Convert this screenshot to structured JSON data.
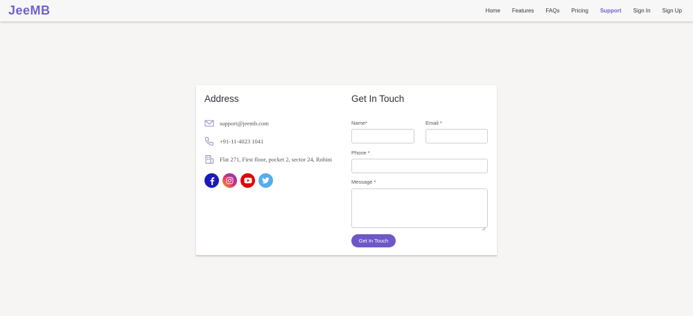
{
  "header": {
    "logo": "JeeMB",
    "nav": [
      {
        "label": "Home"
      },
      {
        "label": "Features"
      },
      {
        "label": "FAQs"
      },
      {
        "label": "Pricing"
      },
      {
        "label": "Support",
        "active": true
      },
      {
        "label": "Sign In"
      },
      {
        "label": "Sign Up"
      }
    ]
  },
  "address": {
    "title": "Address",
    "email": "support@jeemb.com",
    "phone": "+91-11-4023 1041",
    "location": "Flat 271, First floor, pocket 2, sector 24, Rohini",
    "icons": [
      "envelope-icon",
      "phone-icon",
      "building-icon"
    ],
    "social": [
      {
        "name": "facebook-icon",
        "color": "#1a1abf"
      },
      {
        "name": "instagram-icon",
        "color": "#d62976"
      },
      {
        "name": "youtube-icon",
        "color": "#e00000"
      },
      {
        "name": "twitter-icon",
        "color": "#55acee"
      }
    ]
  },
  "form": {
    "title": "Get In Touch",
    "name_label": "Name*",
    "email_label": "Email *",
    "phone_label": "Phone *",
    "message_label": "Message *",
    "name_value": "",
    "email_value": "",
    "phone_value": "",
    "message_value": "",
    "submit_label": "Get In Touch"
  },
  "colors": {
    "accent": "#6f63c9",
    "button": "#6f57c7",
    "background": "#f6f5f3"
  }
}
